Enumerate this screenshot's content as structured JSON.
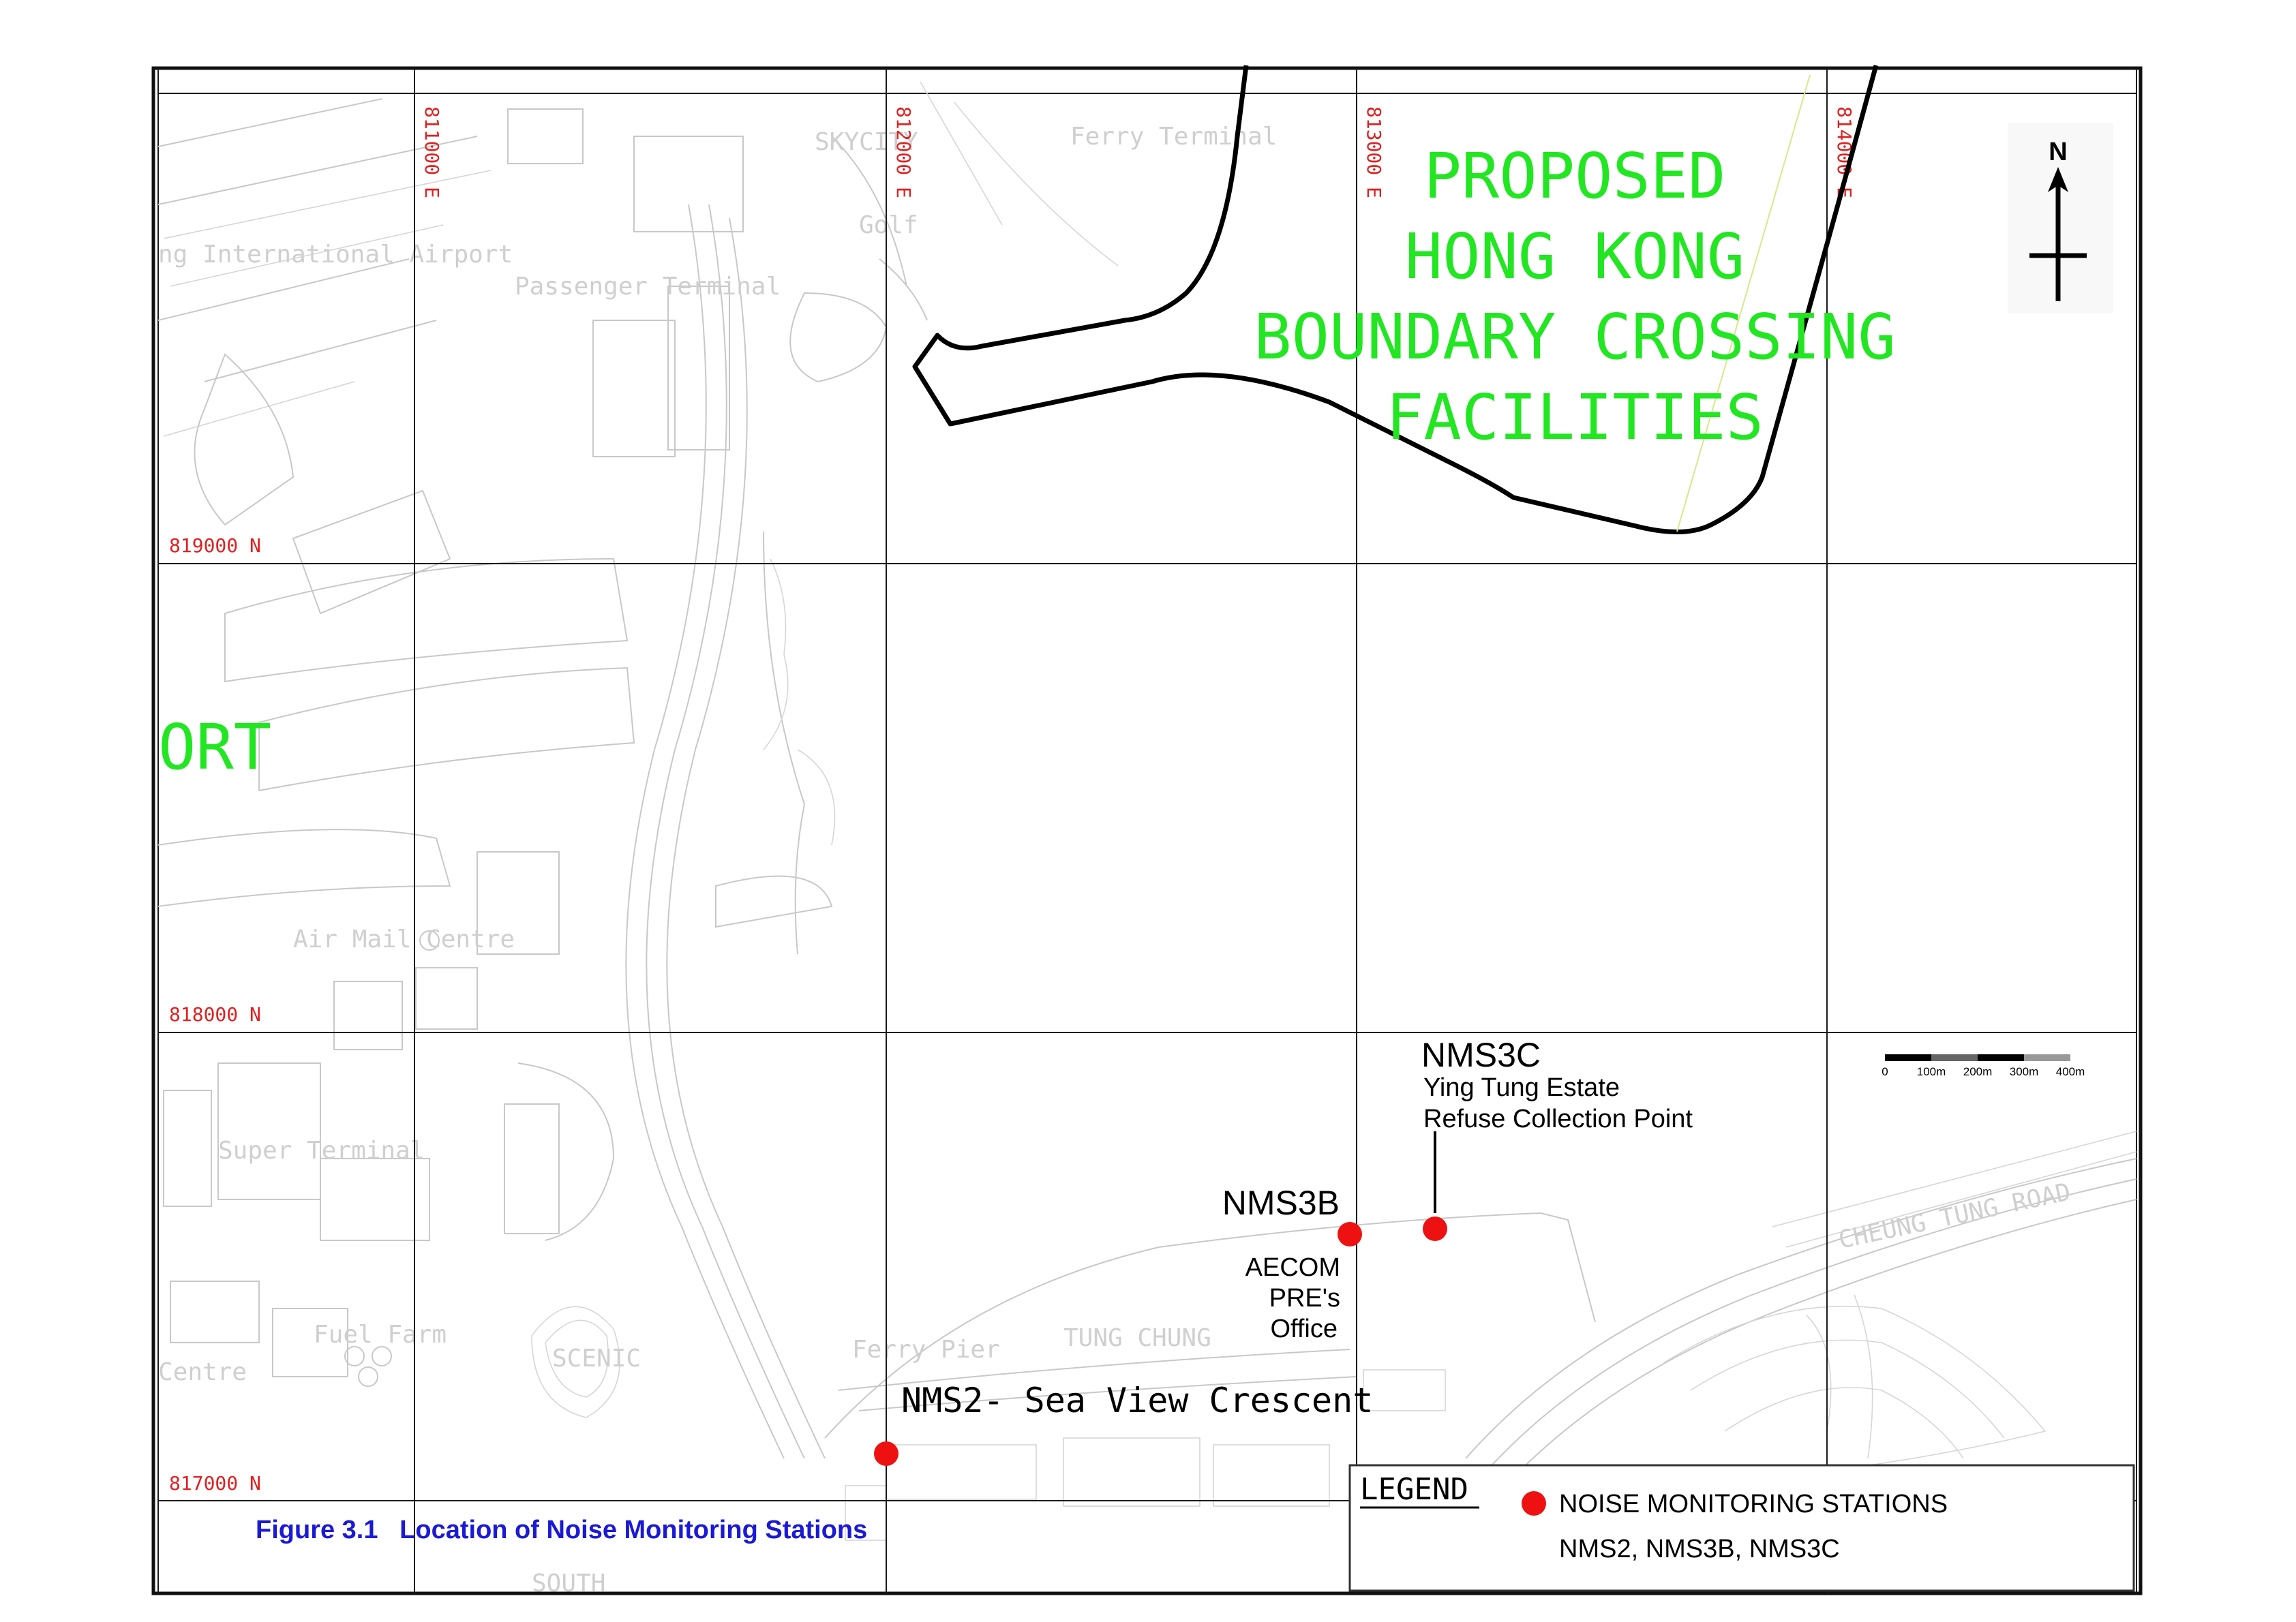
{
  "figure": {
    "caption": "Figure 3.1   Location of Noise Monitoring Stations",
    "caption_color": "#1a1ad6"
  },
  "grid": {
    "eastings": [
      "811000 E",
      "812000 E",
      "813000 E",
      "814000 E"
    ],
    "northings": [
      "819000 N",
      "818000 N",
      "817000 N"
    ],
    "label_color": "#e02020"
  },
  "project_area": {
    "label_lines": [
      "PROPOSED",
      "HONG KONG",
      "BOUNDARY CROSSING",
      "FACILITIES"
    ],
    "label_color": "#22e622"
  },
  "partial_labels": {
    "airport_fragment": "ORT"
  },
  "north_arrow": {
    "label": "N",
    "icon": "north-arrow-icon"
  },
  "scale_bar": {
    "labels": [
      "0",
      "100m",
      "200m",
      "300m",
      "400m"
    ],
    "total_meters": 400
  },
  "stations": [
    {
      "code": "NMS3C",
      "description_lines": [
        "Ying Tung Estate",
        "Refuse Collection Point"
      ]
    },
    {
      "code": "NMS3B",
      "description_lines": [
        "AECOM",
        "PRE's",
        "Office"
      ]
    },
    {
      "code": "NMS2- Sea View Crescent",
      "description_lines": []
    }
  ],
  "station_marker_color": "#ee1111",
  "background_labels": {
    "airport": "ng International Airport",
    "passenger_terminal": "Passenger Terminal",
    "skycity": "SKYCITY",
    "ferry_terminal_top": "Ferry Terminal",
    "golf": "Golf",
    "air_mail_centre": "Air Mail Centre",
    "super_terminal": "Super Terminal",
    "tung_chung": "TUNG CHUNG",
    "scenic": "SCENIC",
    "fuel_farm": "Fuel Farm",
    "ferry_pier": "Ferry Pier",
    "cheung_tung_road": "CHEUNG TUNG ROAD",
    "centre": "Centre",
    "south": "SOUTH"
  },
  "legend": {
    "title": "LEGEND",
    "item_label": "NOISE MONITORING STATIONS",
    "item_sub": "NMS2, NMS3B, NMS3C"
  }
}
